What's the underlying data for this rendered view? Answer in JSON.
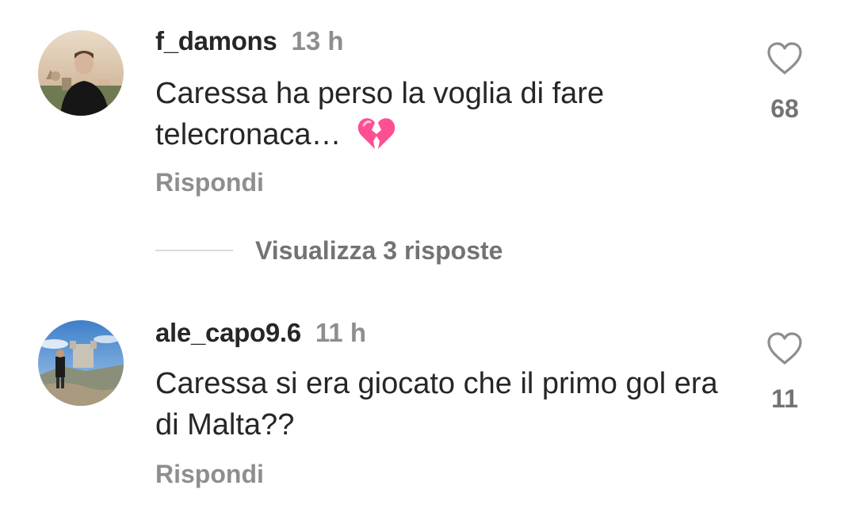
{
  "comments": [
    {
      "username": "f_damons",
      "time": "13 h",
      "text": "Caressa ha perso la voglia di fare telecronaca…",
      "emoji": "broken-heart-icon",
      "reply_label": "Rispondi",
      "likes": "68"
    },
    {
      "username": "ale_capo9.6",
      "time": "11 h",
      "text": "Caressa si era giocato che il primo gol era di Malta??",
      "reply_label": "Rispondi",
      "likes": "11"
    }
  ],
  "view_replies": {
    "label": "Visualizza 3 risposte"
  },
  "colors": {
    "text": "#262626",
    "secondary": "#8e8e8e",
    "emoji": "#ff4f93"
  }
}
